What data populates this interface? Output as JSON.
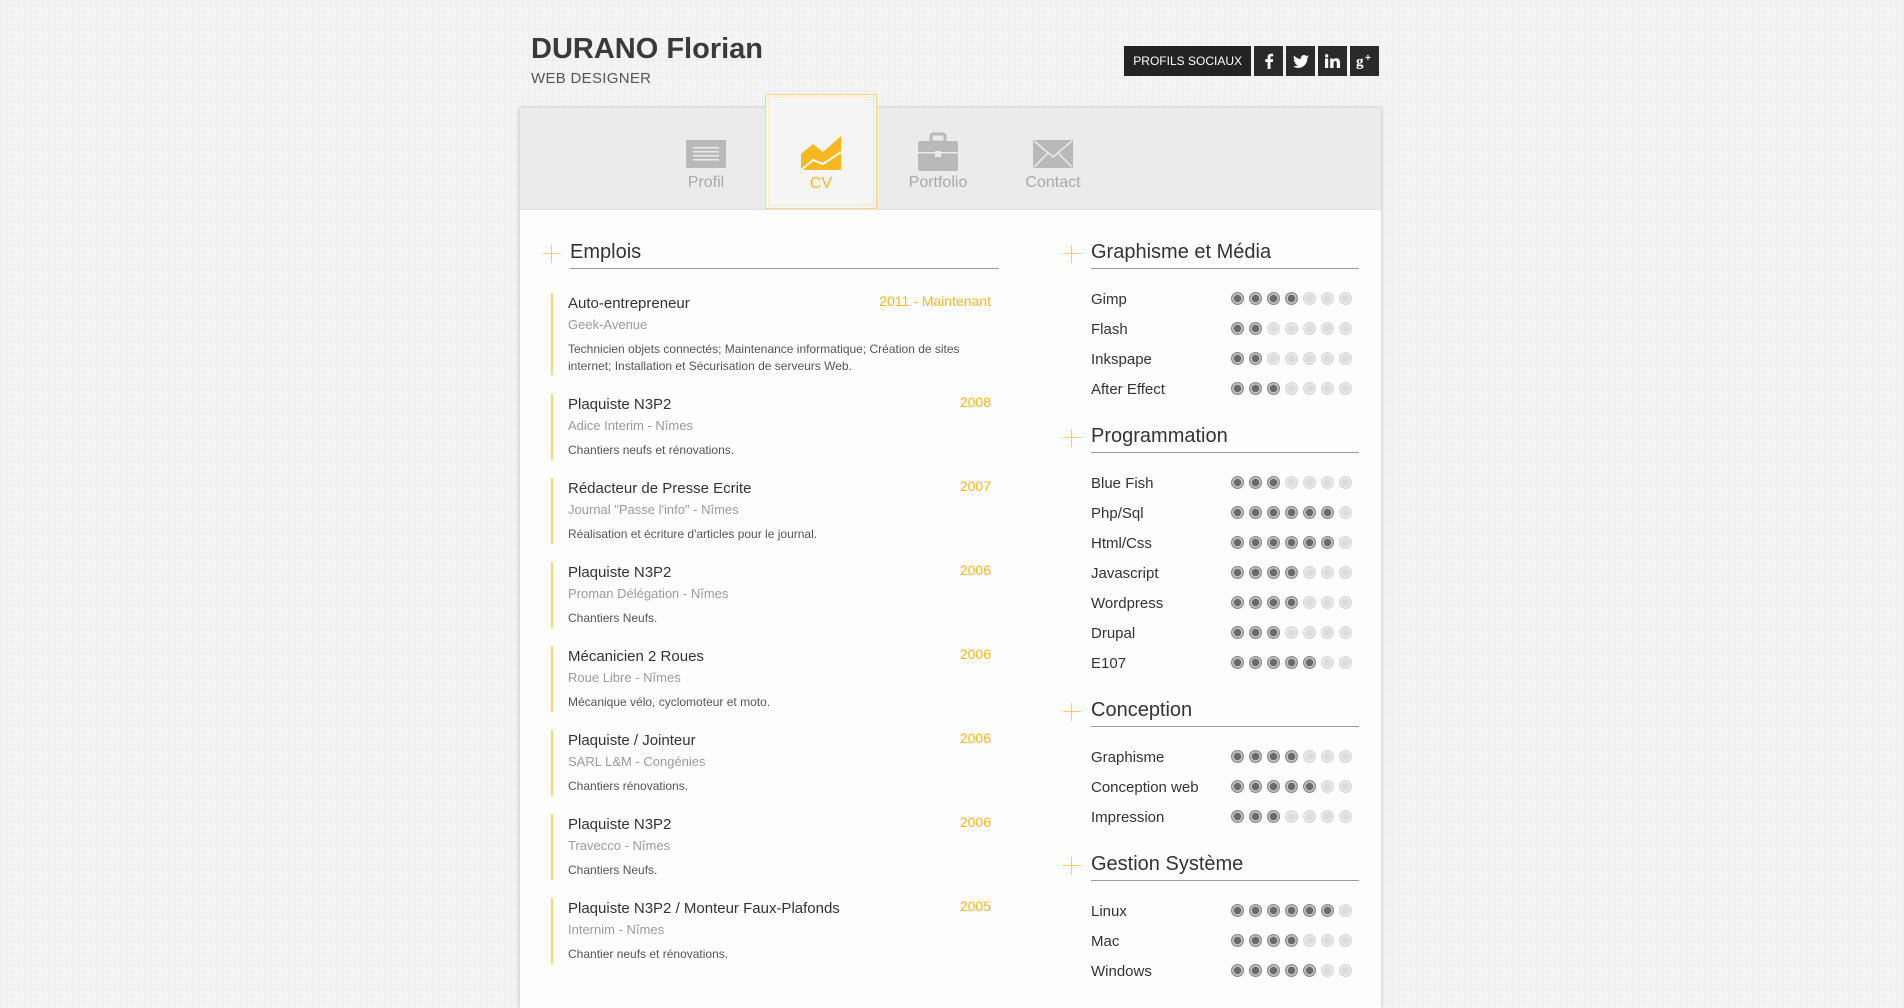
{
  "header": {
    "name": "DURANO Florian",
    "role": "WEB DESIGNER"
  },
  "social": {
    "label": "PROFILS SOCIAUX",
    "icons": [
      "facebook-icon",
      "twitter-icon",
      "linkedin-icon",
      "google-plus-icon"
    ]
  },
  "nav": {
    "items": [
      {
        "label": "Profil",
        "icon": "document-icon"
      },
      {
        "label": "CV",
        "icon": "chart-icon",
        "active": true
      },
      {
        "label": "Portfolio",
        "icon": "briefcase-icon"
      },
      {
        "label": "Contact",
        "icon": "envelope-icon"
      }
    ]
  },
  "colors": {
    "accent": "#f5b820",
    "dark": "#232323",
    "line": "#f8d57a"
  },
  "emplois": {
    "title": "Emplois",
    "jobs": [
      {
        "title": "Auto-entrepreneur",
        "date": "2011 - Maintenant",
        "company": "Geek-Avenue",
        "desc": "Technicien objets connectés; Maintenance informatique; Création de sites internet; Installation et Sécurisation de serveurs Web."
      },
      {
        "title": "Plaquiste N3P2",
        "date": "2008",
        "company": "Adice Interim - Nîmes",
        "desc": "Chantiers neufs et rénovations."
      },
      {
        "title": "Rédacteur de Presse Ecrite",
        "date": "2007",
        "company": "Journal \"Passe l'info\" - Nîmes",
        "desc": "Réalisation et écriture d'articles pour le journal."
      },
      {
        "title": "Plaquiste N3P2",
        "date": "2006",
        "company": "Proman Délégation - Nîmes",
        "desc": "Chantiers Neufs."
      },
      {
        "title": "Mécanicien 2 Roues",
        "date": "2006",
        "company": "Roue Libre - Nîmes",
        "desc": "Mécanique vélo, cyclomoteur et moto."
      },
      {
        "title": "Plaquiste / Jointeur",
        "date": "2006",
        "company": "SARL L&M - Congénies",
        "desc": "Chantiers rénovations."
      },
      {
        "title": "Plaquiste N3P2",
        "date": "2006",
        "company": "Travecco - Nîmes",
        "desc": "Chantiers Neufs."
      },
      {
        "title": "Plaquiste N3P2 / Monteur Faux-Plafonds",
        "date": "2005",
        "company": "Internim - Nîmes",
        "desc": "Chantier neufs et rénovations."
      }
    ]
  },
  "skills": [
    {
      "title": "Graphisme et Média",
      "items": [
        {
          "name": "Gimp",
          "level": 4,
          "max": 7
        },
        {
          "name": "Flash",
          "level": 2,
          "max": 7
        },
        {
          "name": "Inkspape",
          "level": 2,
          "max": 7
        },
        {
          "name": "After Effect",
          "level": 3,
          "max": 7
        }
      ]
    },
    {
      "title": "Programmation",
      "items": [
        {
          "name": "Blue Fish",
          "level": 3,
          "max": 7
        },
        {
          "name": "Php/Sql",
          "level": 6,
          "max": 7
        },
        {
          "name": "Html/Css",
          "level": 6,
          "max": 7
        },
        {
          "name": "Javascript",
          "level": 4,
          "max": 7
        },
        {
          "name": "Wordpress",
          "level": 4,
          "max": 7
        },
        {
          "name": "Drupal",
          "level": 3,
          "max": 7
        },
        {
          "name": "E107",
          "level": 5,
          "max": 7
        }
      ]
    },
    {
      "title": "Conception",
      "items": [
        {
          "name": "Graphisme",
          "level": 4,
          "max": 7
        },
        {
          "name": "Conception web",
          "level": 5,
          "max": 7
        },
        {
          "name": "Impression",
          "level": 3,
          "max": 7
        }
      ]
    },
    {
      "title": "Gestion Système",
      "items": [
        {
          "name": "Linux",
          "level": 6,
          "max": 7
        },
        {
          "name": "Mac",
          "level": 4,
          "max": 7
        },
        {
          "name": "Windows",
          "level": 5,
          "max": 7
        }
      ]
    }
  ]
}
